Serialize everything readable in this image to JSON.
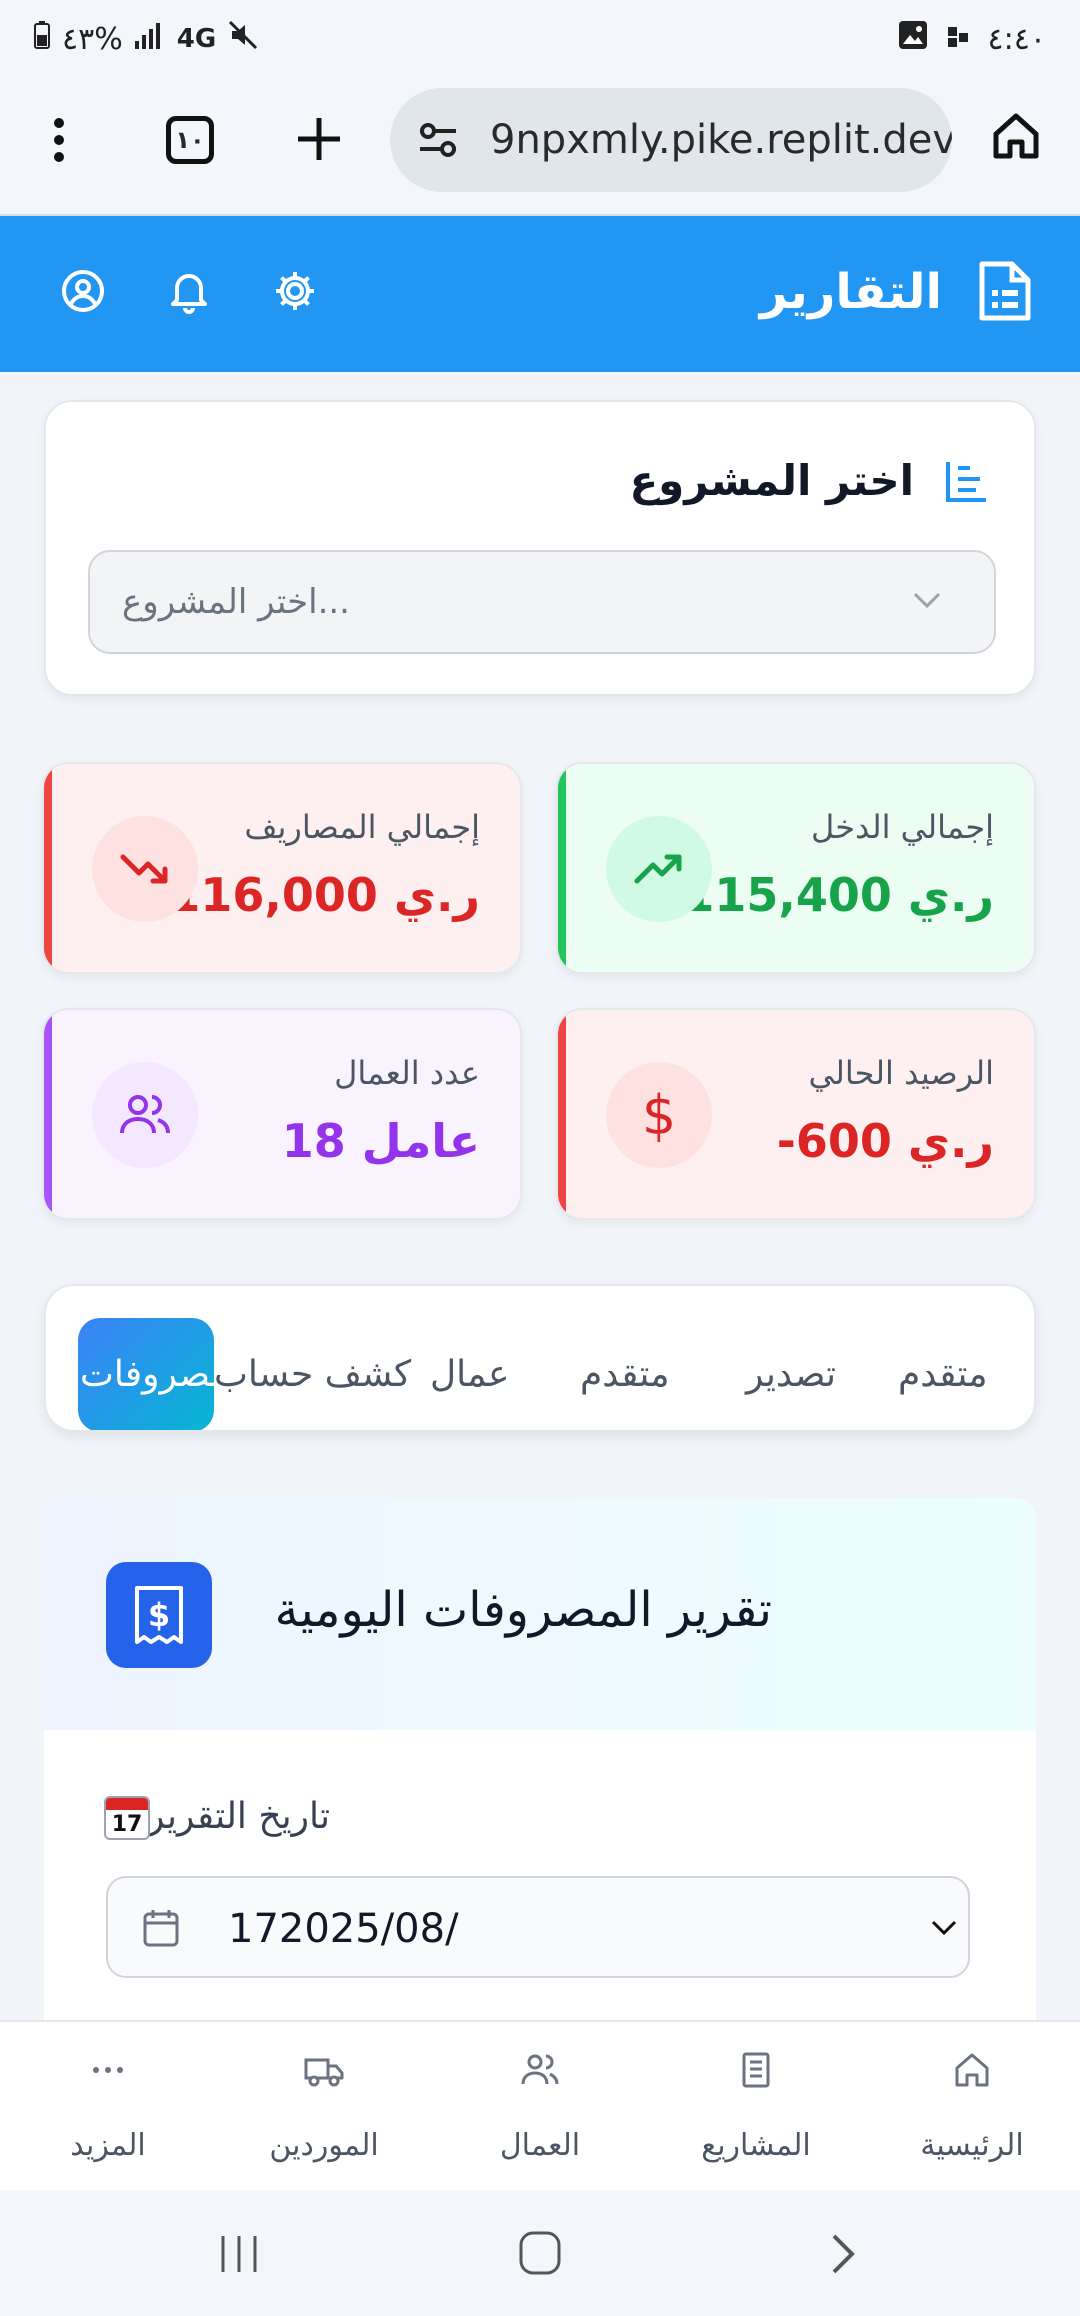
{
  "status_bar": {
    "battery": "٤٣%",
    "network": "4G",
    "time": "٤:٤٠"
  },
  "browser": {
    "url": "9npxmly.pike.replit.dev",
    "tab_count": "١٠"
  },
  "app": {
    "title": "التقارير",
    "accent": "#2196f3"
  },
  "project_select": {
    "title": "اختر المشروع",
    "placeholder": "اختر المشروع..."
  },
  "stats": {
    "expenses": {
      "label": "إجمالي المصاريف",
      "value": "116,000 ر.ي",
      "color": "#dc2626"
    },
    "income": {
      "label": "إجمالي الدخل",
      "value": "115,400 ر.ي",
      "color": "#16a34a"
    },
    "workers": {
      "label": "عدد العمال",
      "value": "18 عامل",
      "color": "#9333ea"
    },
    "balance": {
      "label": "الرصيد الحالي",
      "value": "-600 ر.ي",
      "color": "#dc2626"
    }
  },
  "tabs": {
    "items": [
      "متقدم",
      "تصدير",
      "متقدم",
      "عمال",
      "كشف حساب"
    ],
    "active": "مصروفات"
  },
  "report": {
    "title": "تقرير المصروفات اليومية",
    "date_label": "تاريخ التقرير",
    "date_value": "172025/08/"
  },
  "bottom_nav": {
    "home": "الرئيسية",
    "projects": "المشاريع",
    "workers": "العمال",
    "suppliers": "الموردين",
    "more": "المزيد"
  }
}
